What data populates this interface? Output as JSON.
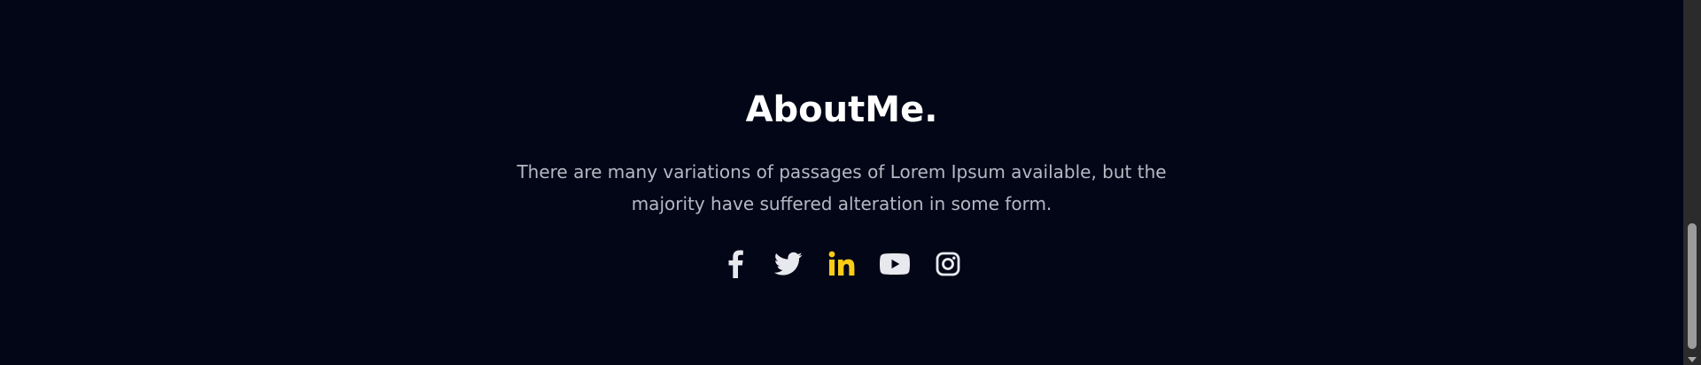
{
  "about": {
    "title": "AboutMe.",
    "description": "There are many variations of passages of Lorem Ipsum available, but the majority have suffered alteration in some form."
  },
  "socials": [
    {
      "name": "facebook",
      "icon": "facebook-icon",
      "active": false
    },
    {
      "name": "twitter",
      "icon": "twitter-icon",
      "active": false
    },
    {
      "name": "linkedin",
      "icon": "linkedin-icon",
      "active": true
    },
    {
      "name": "youtube",
      "icon": "youtube-icon",
      "active": false
    },
    {
      "name": "instagram",
      "icon": "instagram-icon",
      "active": false
    }
  ],
  "colors": {
    "background": "#020617",
    "title": "#ffffff",
    "text": "#b6b9c4",
    "icon": "#e7e9ef",
    "accent": "#facc15"
  }
}
